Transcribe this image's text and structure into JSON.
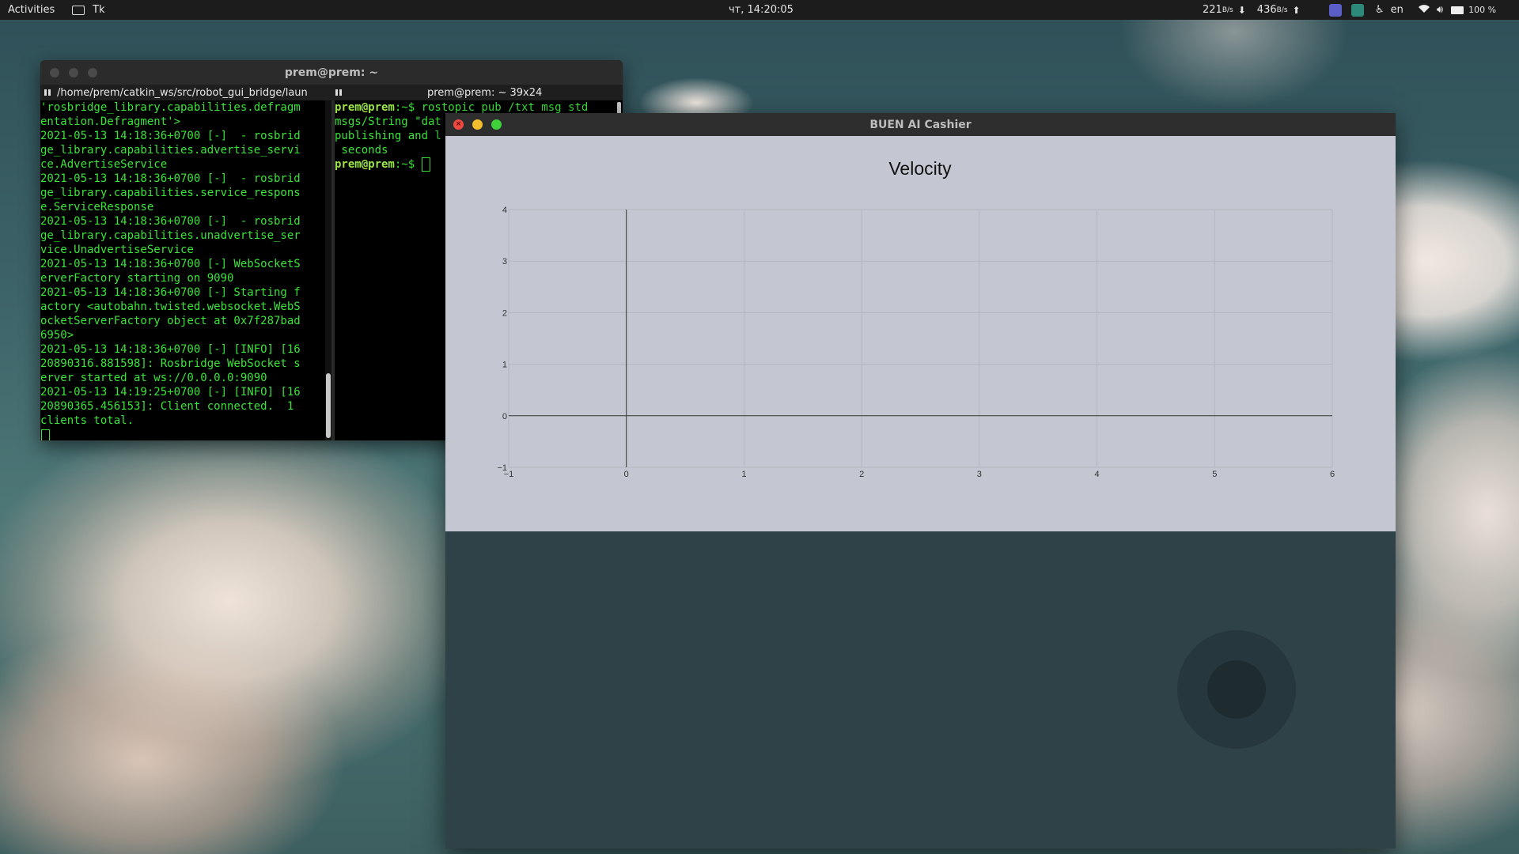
{
  "topbar": {
    "activities": "Activities",
    "app_name": "Tk",
    "clock": "чт, 14:20:05",
    "net_down": "221",
    "net_down_unit": "B/s",
    "net_up": "436",
    "net_up_unit": "B/s",
    "language": "en",
    "battery": "100 %",
    "icons": [
      "window-icon",
      "download-arrow-icon",
      "upload-arrow-icon",
      "teams-icon",
      "system-monitor-icon",
      "accessibility-icon",
      "wifi-icon",
      "volume-icon",
      "battery-icon"
    ]
  },
  "terminal": {
    "title": "prem@prem: ~",
    "tab1_label": "/home/prem/catkin_ws/src/robot_gui_bridge/laun",
    "tab2_label": "prem@prem: ~ 39x24",
    "left_lines": [
      "'rosbridge_library.capabilities.defragm",
      "entation.Defragment'>",
      "2021-05-13 14:18:36+0700 [-]  - rosbrid",
      "ge_library.capabilities.advertise_servi",
      "ce.AdvertiseService",
      "2021-05-13 14:18:36+0700 [-]  - rosbrid",
      "ge_library.capabilities.service_respons",
      "e.ServiceResponse",
      "2021-05-13 14:18:36+0700 [-]  - rosbrid",
      "ge_library.capabilities.unadvertise_ser",
      "vice.UnadvertiseService",
      "2021-05-13 14:18:36+0700 [-] WebSocketS",
      "erverFactory starting on 9090",
      "2021-05-13 14:18:36+0700 [-] Starting f",
      "actory <autobahn.twisted.websocket.WebS",
      "ocketServerFactory object at 0x7f287bad",
      "6950>",
      "2021-05-13 14:18:36+0700 [-] [INFO] [16",
      "20890316.881598]: Rosbridge WebSocket s",
      "erver started at ws://0.0.0.0:9090",
      "2021-05-13 14:19:25+0700 [-] [INFO] [16",
      "20890365.456153]: Client connected.  1",
      "clients total."
    ],
    "right_prompt": "prem@prem",
    "right_prompt_suffix": ":~$ ",
    "right_command": "rostopic pub /txt_msg std_",
    "right_lines": [
      "msgs/String \"dat",
      "publishing and l",
      " seconds"
    ]
  },
  "app": {
    "title": "BUEN AI Cashier",
    "close_glyph": "×"
  },
  "chart_data": {
    "type": "line",
    "title": "Velocity",
    "xlabel": "",
    "ylabel": "",
    "xlim": [
      -1,
      6
    ],
    "ylim": [
      -1,
      4
    ],
    "x_ticks": [
      "−1",
      "0",
      "1",
      "2",
      "3",
      "4",
      "5",
      "6"
    ],
    "y_ticks": [
      "−1",
      "0",
      "1",
      "2",
      "3",
      "4"
    ],
    "grid": true,
    "series": [],
    "axis_color": "#333333",
    "grid_color": "#b3b6c0",
    "background": "#c4c7d1"
  },
  "colors": {
    "terminal_text": "#3be339",
    "control_bg": "#2e4248",
    "joystick_outer": "#26383d",
    "joystick_inner": "#1e2c30"
  }
}
